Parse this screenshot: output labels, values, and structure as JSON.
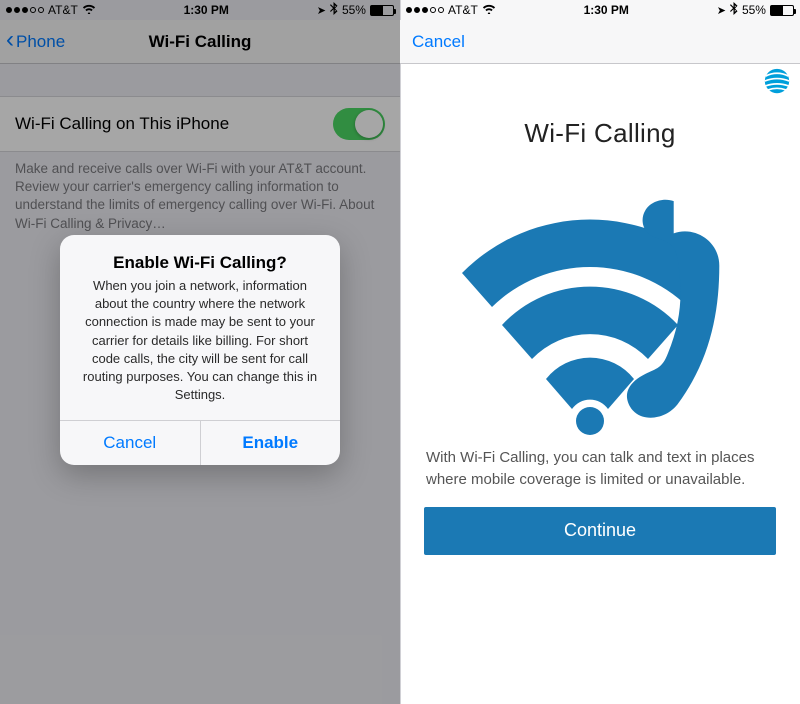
{
  "left": {
    "statusbar": {
      "carrier": "AT&T",
      "time": "1:30 PM",
      "battery": "55%"
    },
    "nav": {
      "back": "Phone",
      "title": "Wi-Fi Calling"
    },
    "row_label": "Wi-Fi Calling on This iPhone",
    "footer": "Make and receive calls over Wi-Fi with your AT&T account. Review your carrier's emergency calling information to understand the limits of emergency calling over Wi-Fi. About Wi-Fi Calling & Privacy…",
    "alert": {
      "title": "Enable Wi-Fi Calling?",
      "body": "When you join a network, information about the country where the network connection is made may be sent to your carrier for details like billing. For short code calls, the city will be sent for call routing purposes. You can change this in Settings.",
      "cancel": "Cancel",
      "enable": "Enable"
    }
  },
  "right": {
    "statusbar": {
      "carrier": "AT&T",
      "time": "1:30 PM",
      "battery": "55%"
    },
    "nav": {
      "cancel": "Cancel"
    },
    "title": "Wi-Fi Calling",
    "body": "With Wi-Fi Calling, you can talk and text in places where mobile coverage is limited or unavailable.",
    "continue": "Continue"
  },
  "colors": {
    "accent_blue": "#1b79b4",
    "ios_blue": "#007aff",
    "toggle_green": "#4cd964"
  }
}
